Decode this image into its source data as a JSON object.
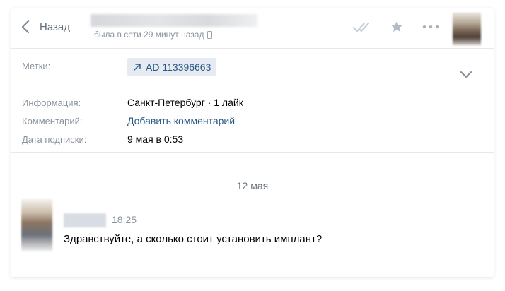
{
  "header": {
    "back_label": "Назад",
    "status": "была в сети 29 минут назад",
    "icons": [
      "chevron-left-icon",
      "phone-icon",
      "double-check-icon",
      "star-icon",
      "more-icon"
    ]
  },
  "info": {
    "tags_label": "Метки:",
    "tag_value": "AD 113396663",
    "info_label": "Информация:",
    "info_value": "Санкт-Петербург · 1 лайк",
    "comment_label": "Комментарий:",
    "comment_value": "Добавить комментарий",
    "subscribe_label": "Дата подписки:",
    "subscribe_value": "9 мая в 0:53"
  },
  "messages": {
    "date": "12 мая",
    "items": [
      {
        "time": "18:25",
        "text": "Здравствуйте, а сколько стоит установить имплант?"
      }
    ]
  },
  "colors": {
    "link": "#2a5885",
    "muted": "#8a939d",
    "tag_bg": "#e5ebf1",
    "divider": "#e7e8ec"
  }
}
